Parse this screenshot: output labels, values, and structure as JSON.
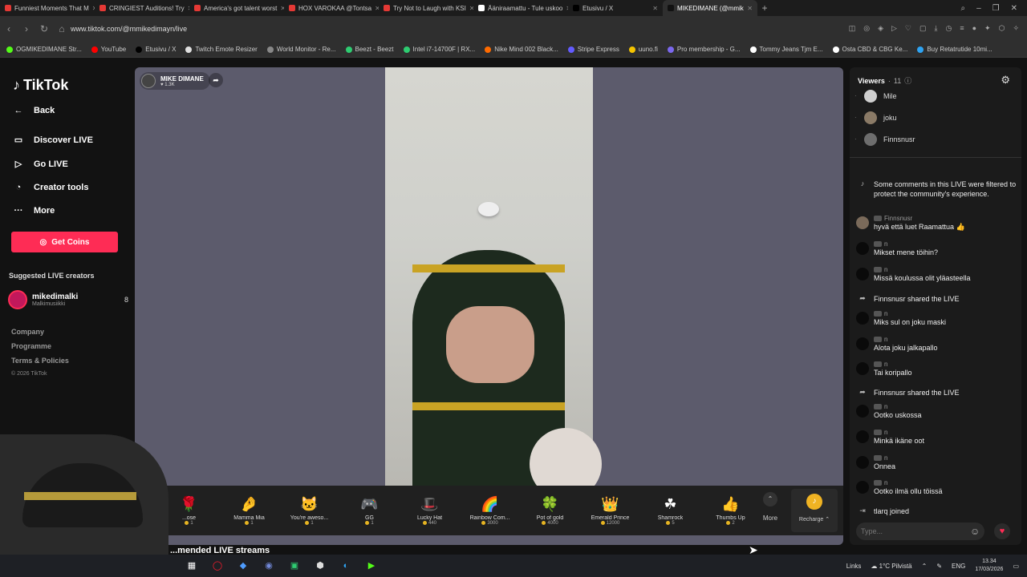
{
  "browser": {
    "tabs": [
      {
        "label": "Funniest Moments That M",
        "color": "#e53935"
      },
      {
        "label": "CRINGIEST Auditions! Try",
        "color": "#e53935"
      },
      {
        "label": "America's got talent worst",
        "color": "#e53935"
      },
      {
        "label": "HOX VAROKAA @Tontsa",
        "color": "#e53935"
      },
      {
        "label": "Try Not to Laugh with KSI",
        "color": "#e53935"
      },
      {
        "label": "Ääniraamattu - Tule uskoo",
        "color": "#ffffff"
      },
      {
        "label": "Etusivu / X",
        "color": "#000000"
      },
      {
        "label": "MIKEDIMANE (@mmik",
        "color": "#111111",
        "active": true
      }
    ],
    "url": "www.tiktok.com/@mmikedimayn/live",
    "bookmarks": [
      "OGMIKEDIMANE Str...",
      "YouTube",
      "Etusivu / X",
      "Twitch Emote Resizer",
      "World Monitor - Re...",
      "Beezt - Beezt",
      "Intel i7-14700F | RX...",
      "Nike Mind 002 Black...",
      "Stripe Express",
      "uuno.fi",
      "Pro membership - G...",
      "Tommy Jeans Tjm E...",
      "Osta CBD & CBG Ke...",
      "Buy Retatrutide 10mi..."
    ]
  },
  "sidebar": {
    "logo": "TikTok",
    "nav": [
      {
        "label": "Back",
        "icon": "arrow-left-icon"
      },
      {
        "label": "Discover LIVE",
        "icon": "live-icon"
      },
      {
        "label": "Go LIVE",
        "icon": "camera-icon"
      },
      {
        "label": "Creator tools",
        "icon": "tools-icon"
      },
      {
        "label": "More",
        "icon": "dots-icon"
      }
    ],
    "get_coins": "Get Coins",
    "suggested_title": "Suggested LIVE creators",
    "creator": {
      "name": "mikedimalki",
      "sub": "Malkimusiikki",
      "count": "8"
    },
    "footer": [
      "Company",
      "Programme",
      "Terms & Policies"
    ],
    "copyright": "© 2026 TikTok"
  },
  "stream": {
    "host_name": "MIKE DIMANE",
    "host_likes": "1.3K",
    "recommended_title": "...mended LIVE streams"
  },
  "gifts": [
    {
      "name": "...ose",
      "price": "1",
      "glyph": "🌹"
    },
    {
      "name": "Mamma Mia",
      "price": "1",
      "glyph": "🤌"
    },
    {
      "name": "You're aweso...",
      "price": "1",
      "glyph": "🐱"
    },
    {
      "name": "GG",
      "price": "1",
      "glyph": "🎮"
    },
    {
      "name": "Lucky Hat",
      "price": "440",
      "glyph": "🎩"
    },
    {
      "name": "Rainbow Com...",
      "price": "3000",
      "glyph": "🌈"
    },
    {
      "name": "Pot of gold",
      "price": "4000",
      "glyph": "🍀"
    },
    {
      "name": "Emerald Prince",
      "price": "12000",
      "glyph": "👑"
    },
    {
      "name": "Shamrock",
      "price": "5",
      "glyph": "☘"
    },
    {
      "name": "Thumbs Up",
      "price": "2",
      "glyph": "👍"
    }
  ],
  "gift_more": "More",
  "recharge": "Recharge",
  "chat": {
    "viewers_label": "Viewers",
    "viewers_count": "11",
    "viewers": [
      "Mile",
      "joku",
      "Finnsnusr"
    ],
    "system_notice": "Some comments in this LIVE were filtered to protect the community's experience.",
    "messages": [
      {
        "user": "Finnsnusr",
        "text": "hyvä että luet Raamattua 👍"
      },
      {
        "user": "n",
        "text": "Mikset mene töihin?"
      },
      {
        "user": "n",
        "text": "Missä koulussa olit yläasteella"
      },
      {
        "event": "Finnsnusr shared the LIVE"
      },
      {
        "user": "n",
        "text": "Miks sul on joku maski"
      },
      {
        "user": "n",
        "text": "Alota joku jalkapallo"
      },
      {
        "user": "n",
        "text": "Tai koripallo"
      },
      {
        "event": "Finnsnusr shared the LIVE"
      },
      {
        "user": "n",
        "text": "Ootko uskossa"
      },
      {
        "user": "n",
        "text": "Minkä ikäne oot"
      },
      {
        "user": "n",
        "text": "Onnea"
      },
      {
        "user": "n",
        "text": "Ootko ilmä ollu töissä"
      },
      {
        "event": "tlarq joined"
      }
    ],
    "placeholder": "Type..."
  },
  "taskbar": {
    "links": "Links",
    "weather": "1°C Pilvistä",
    "lang": "ENG",
    "time": "13.34",
    "date": "17/03/2026"
  }
}
